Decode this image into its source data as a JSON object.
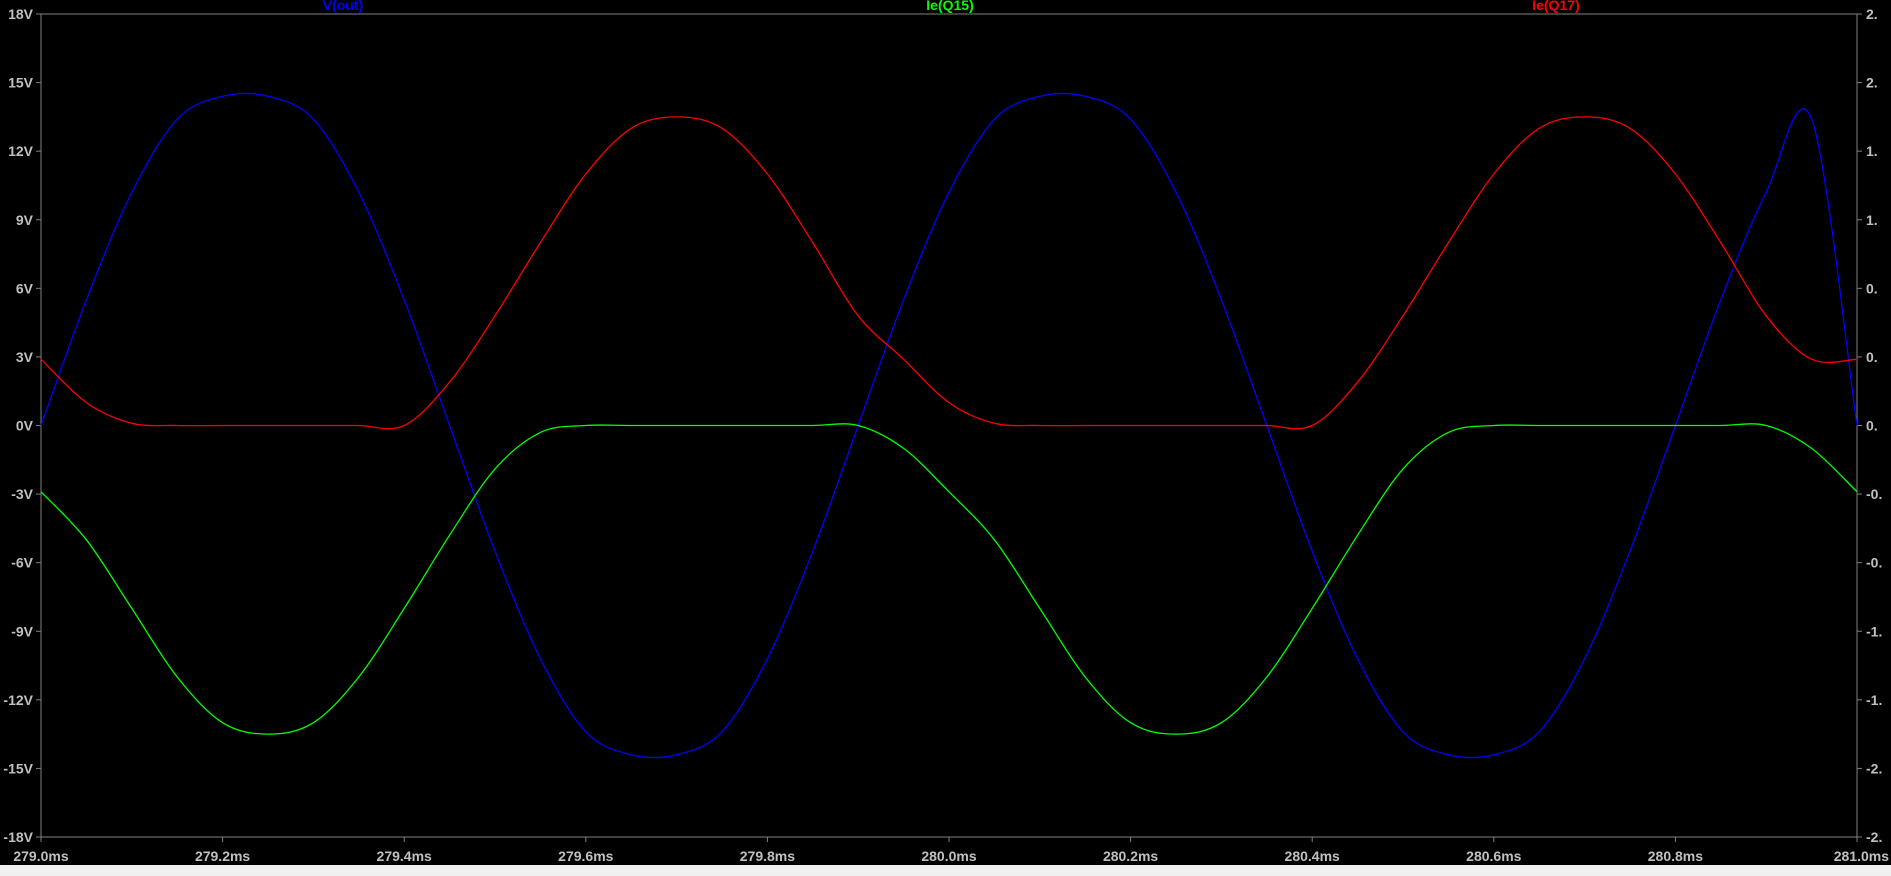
{
  "chart_data": {
    "type": "line",
    "title": "",
    "xlabel": "",
    "ylabel": "",
    "xlim": [
      279.0,
      281.0
    ],
    "ylim": [
      -18,
      18
    ],
    "x_ticks": [
      "279.0ms",
      "279.2ms",
      "279.4ms",
      "279.6ms",
      "279.8ms",
      "280.0ms",
      "280.2ms",
      "280.4ms",
      "280.6ms",
      "280.8ms",
      "281.0ms"
    ],
    "y_ticks": [
      "18V",
      "15V",
      "12V",
      "9V",
      "6V",
      "3V",
      "0V",
      "-3V",
      "-6V",
      "-9V",
      "-12V",
      "-15V",
      "-18V"
    ],
    "y2_ticks": [
      "2.",
      "2.",
      "1.",
      "1.",
      "0.",
      "0.",
      "0.",
      "-0.",
      "-0.",
      "-1.",
      "-1.",
      "-2.",
      "-2."
    ],
    "grid": false,
    "legend_position": "top",
    "x": [
      279.0,
      279.05,
      279.1,
      279.15,
      279.2,
      279.25,
      279.3,
      279.35,
      279.4,
      279.45,
      279.5,
      279.55,
      279.6,
      279.65,
      279.7,
      279.75,
      279.8,
      279.85,
      279.9,
      279.95,
      280.0,
      280.05,
      280.1,
      280.15,
      280.2,
      280.25,
      280.3,
      280.35,
      280.4,
      280.45,
      280.5,
      280.55,
      280.6,
      280.65,
      280.7,
      280.75,
      280.8,
      280.85,
      280.9,
      280.95,
      281.0
    ],
    "series": [
      {
        "name": "V(out)",
        "color": "#0000ff",
        "axis": "left",
        "values": [
          0,
          5.5,
          10.2,
          13.4,
          14.4,
          14.4,
          13.4,
          10.2,
          5.5,
          0,
          -5.5,
          -10.2,
          -13.4,
          -14.4,
          -14.4,
          -13.4,
          -10.2,
          -5.5,
          0,
          5.5,
          10.2,
          13.4,
          14.4,
          14.4,
          13.4,
          10.2,
          5.5,
          0,
          -5.5,
          -10.2,
          -13.4,
          -14.4,
          -14.4,
          -13.4,
          -10.2,
          -5.5,
          0,
          5.5,
          10.2,
          13.4,
          0
        ]
      },
      {
        "name": "Ie(Q15)",
        "color": "#00ff00",
        "axis": "left",
        "values": [
          -2.9,
          -5.0,
          -8.0,
          -11.0,
          -13.0,
          -13.5,
          -13.0,
          -11.0,
          -8.0,
          -4.8,
          -1.9,
          -0.3,
          0.0,
          0.0,
          0.0,
          0.0,
          0.0,
          0.0,
          0.0,
          -1.0,
          -2.9,
          -5.0,
          -8.0,
          -11.0,
          -13.0,
          -13.5,
          -13.0,
          -11.0,
          -8.0,
          -4.8,
          -1.9,
          -0.3,
          0.0,
          0.0,
          0.0,
          0.0,
          0.0,
          0.0,
          0.0,
          -1.0,
          -2.9
        ]
      },
      {
        "name": "Ie(Q17)",
        "color": "#ff0000",
        "axis": "left",
        "values": [
          2.9,
          1.0,
          0.1,
          0.0,
          0.0,
          0.0,
          0.0,
          0.0,
          0.0,
          1.9,
          4.8,
          8.0,
          11.0,
          13.0,
          13.5,
          13.0,
          11.0,
          8.0,
          4.8,
          2.9,
          1.0,
          0.1,
          0.0,
          0.0,
          0.0,
          0.0,
          0.0,
          0.0,
          0.0,
          1.9,
          4.8,
          8.0,
          11.0,
          13.0,
          13.5,
          13.0,
          11.0,
          8.0,
          4.8,
          2.9,
          2.9
        ]
      }
    ]
  },
  "style": {
    "background": "#000000",
    "axis_color": "#808080",
    "tick_label_color": "#c0c0c0"
  }
}
